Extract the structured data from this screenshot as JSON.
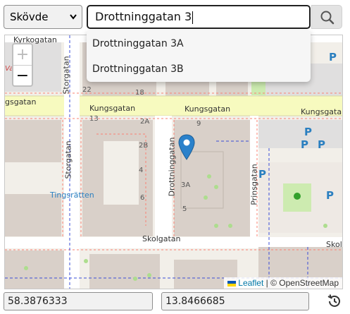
{
  "select": {
    "value": "Skövde"
  },
  "search": {
    "value": "Drottninggatan 3"
  },
  "suggestions": [
    "Drottninggatan 3A",
    "Drottninggatan 3B"
  ],
  "map": {
    "zoom_in": "+",
    "zoom_out": "−",
    "streets": {
      "kyrkogatan": "Kyrkogatan",
      "storgatan_north": "Storgatan",
      "storgatan_south": "Storgatan",
      "gsgatan": "gsgatan",
      "kungsgatan_1": "Kungsgatan",
      "kungsgatan_2": "Kungsgatan",
      "kungsgatan_3": "Kungsgatan",
      "drottninggatan": "Drottninggatan",
      "prinsgatan": "Prinsgatan",
      "skolgatan_1": "Skolgatan",
      "skolgatan_2": "Skol"
    },
    "places": {
      "tingsratten": "Tingsrätten",
      "vasa": "Vasa"
    },
    "numbers": [
      "22",
      "18",
      "13",
      "2A",
      "9",
      "2B",
      "4",
      "6",
      "3A",
      "5"
    ],
    "parking_label": "P",
    "attribution": {
      "leaflet": "Leaflet",
      "separator": " | © ",
      "osm": "OpenStreetMap"
    }
  },
  "coords": {
    "lat": "58.3876333",
    "lng": "13.8466685"
  }
}
